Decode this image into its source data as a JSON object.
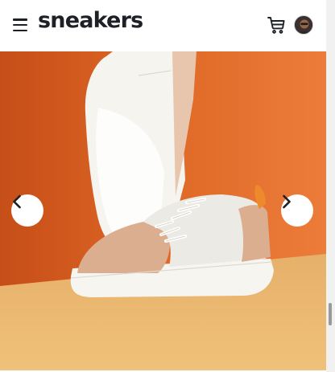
{
  "header": {
    "brand": "sneakers",
    "menu_icon": "hamburger-menu-icon",
    "cart_icon": "cart-icon",
    "avatar_icon": "user-avatar"
  },
  "gallery": {
    "prev_icon": "chevron-left-icon",
    "next_icon": "chevron-right-icon",
    "image": "sneaker-product-photo"
  },
  "colors": {
    "text_dark": "#1d2026",
    "hero_orange": "#e06a2a",
    "floor_tan": "#e5b26a"
  }
}
